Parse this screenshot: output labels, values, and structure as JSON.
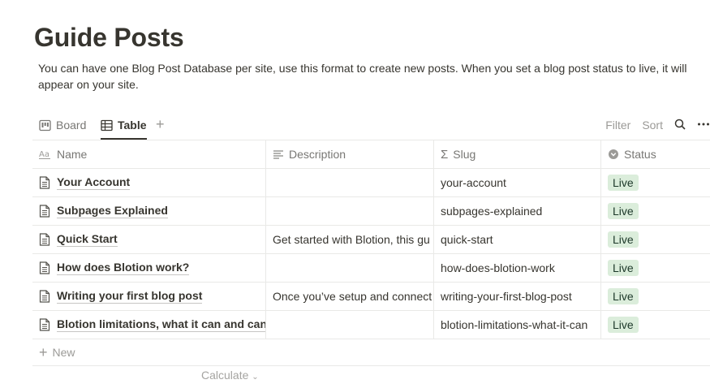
{
  "page": {
    "title": "Guide Posts",
    "description": "You can have one Blog Post Database per site, use this format to create new posts. When you set a blog post status to live, it will appear on your site."
  },
  "views": {
    "tabs": [
      {
        "label": "Board",
        "icon": "board-icon"
      },
      {
        "label": "Table",
        "icon": "table-icon",
        "active": true
      }
    ],
    "add_icon": "plus-icon",
    "tools": {
      "filter": "Filter",
      "sort": "Sort",
      "search_icon": "search-icon",
      "more_icon": "more-icon"
    }
  },
  "table": {
    "columns": [
      {
        "label": "Name",
        "icon": "title-property-icon"
      },
      {
        "label": "Description",
        "icon": "text-property-icon"
      },
      {
        "label": "Slug",
        "icon": "formula-icon"
      },
      {
        "label": "Status",
        "icon": "status-icon"
      }
    ],
    "rows": [
      {
        "name": "Your Account",
        "description": "",
        "slug": "your-account",
        "status": "Live"
      },
      {
        "name": "Subpages Explained",
        "description": "",
        "slug": "subpages-explained",
        "status": "Live"
      },
      {
        "name": "Quick Start",
        "description": "Get started with Blotion, this gu",
        "slug": "quick-start",
        "status": "Live"
      },
      {
        "name": "How does Blotion work?",
        "description": "",
        "slug": "how-does-blotion-work",
        "status": "Live"
      },
      {
        "name": "Writing your first blog post",
        "description": "Once you’ve setup and connect",
        "slug": "writing-your-first-blog-post",
        "status": "Live"
      },
      {
        "name": "Blotion limitations, what it can and can",
        "description": "",
        "slug": "blotion-limitations-what-it-can",
        "status": "Live"
      }
    ],
    "new_label": "New",
    "calculate_label": "Calculate"
  },
  "colors": {
    "status_live_bg": "#dbeddb",
    "status_live_text": "#1c3829",
    "text": "#37352f",
    "muted": "#787774"
  }
}
